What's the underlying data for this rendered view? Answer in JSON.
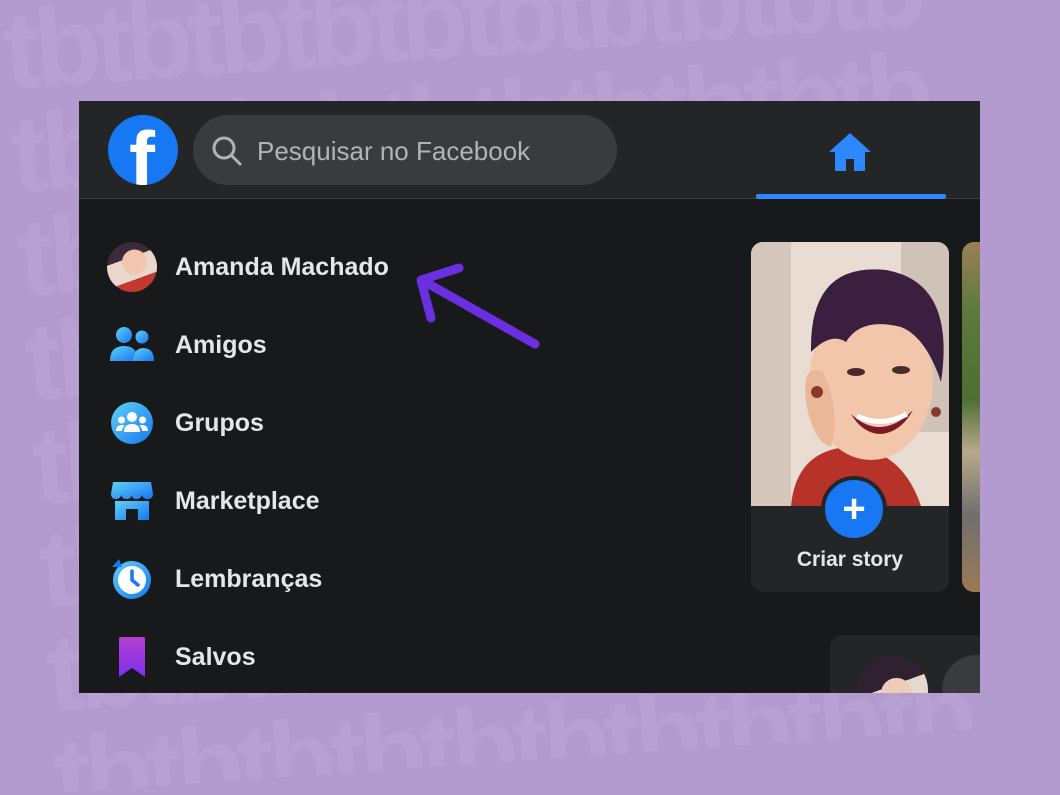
{
  "search": {
    "placeholder": "Pesquisar no Facebook"
  },
  "sidebar": {
    "items": [
      {
        "label": "Amanda Machado",
        "icon": "profile-avatar"
      },
      {
        "label": "Amigos",
        "icon": "friends-icon"
      },
      {
        "label": "Grupos",
        "icon": "groups-icon"
      },
      {
        "label": "Marketplace",
        "icon": "marketplace-icon"
      },
      {
        "label": "Lembranças",
        "icon": "memories-icon"
      },
      {
        "label": "Salvos",
        "icon": "saved-icon"
      }
    ]
  },
  "story": {
    "create_label": "Criar story",
    "plus": "+"
  },
  "logo": {
    "letter": "f"
  },
  "colors": {
    "brand": "#1877f2",
    "background_outer": "#b39bd0",
    "surface": "#242526",
    "page": "#18191a",
    "annotation_arrow": "#6a2fe0"
  }
}
